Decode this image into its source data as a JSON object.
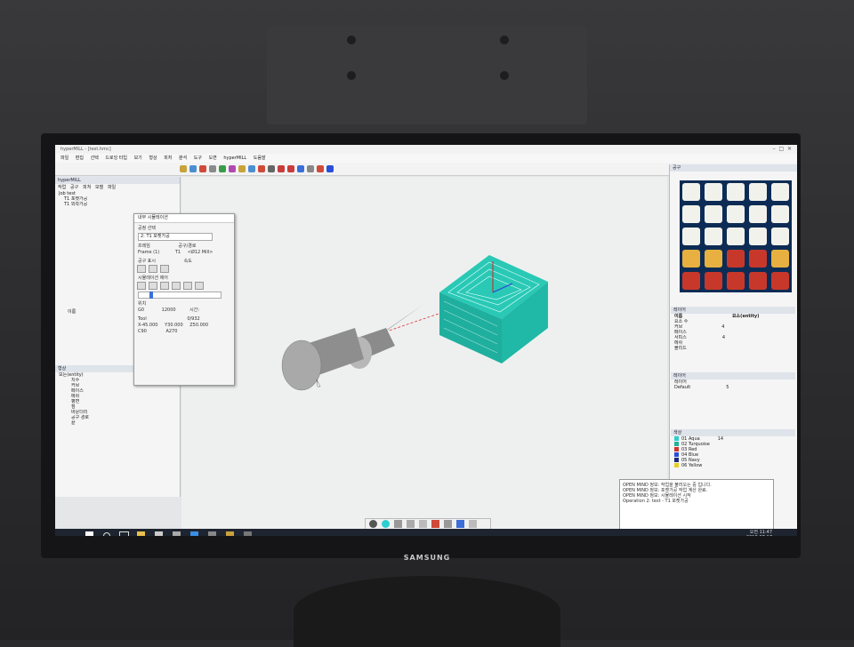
{
  "window": {
    "title": "hyperMILL - [test.hmc]"
  },
  "menu": [
    "파일",
    "편집",
    "선택",
    "드로잉 타입",
    "보기",
    "형상",
    "피처",
    "분석",
    "도구",
    "도면",
    "hyperMILL",
    "도움말"
  ],
  "left_panel": {
    "header": "hyperMILL",
    "tabs": [
      "작업",
      "공구",
      "피쳐",
      "모델",
      "파일"
    ],
    "tree": [
      "Job test",
      "T1 포켓가공",
      "T1 외곽가공"
    ],
    "name_label": "이름"
  },
  "left_bottom": {
    "header": "형상",
    "items": [
      "모든(entity)",
      "치수",
      "커브",
      "페이스",
      "메쉬",
      "평면",
      "점",
      "바운더리",
      "공구 경로",
      "끝"
    ]
  },
  "sim_dialog": {
    "title": "내부 시뮬레이션",
    "operation_label": "공정 선택",
    "operation_value": "2: T1 포켓가공",
    "frame_label": "프레임",
    "frame_value": "Frame (1)",
    "tool_label": "공구/경로",
    "tool_value": "T1",
    "tool_extra": "<Ø12 Mill>",
    "show_label": "공구 표시",
    "speed_label": "속도",
    "sim_label": "시뮬레이션 제어",
    "pos_label": "위치",
    "g_label": "G0",
    "g_value": "12000",
    "time_label": "시간:",
    "tool_info_label": "Tool",
    "count_value": "0/932",
    "x_value": "X-45.000",
    "y_value": "Y30.000",
    "z_value": "Z50.000",
    "c_label": "C90",
    "a_label": "A270"
  },
  "right_panel": {
    "header": "공구",
    "layers_header": "레이어",
    "layers_cols": [
      "이름",
      "요소(entity)"
    ],
    "layers": [
      {
        "name": "요소 수",
        "count": ""
      },
      {
        "name": "커브",
        "count": "4"
      },
      {
        "name": "페이스",
        "count": ""
      },
      {
        "name": "서피스",
        "count": "4"
      },
      {
        "name": "메쉬",
        "count": ""
      },
      {
        "name": "볼리드",
        "count": ""
      }
    ],
    "layer2_header": "레이어",
    "layer2_items": [
      {
        "name": "레이어",
        "count": ""
      },
      {
        "name": "Default",
        "count": "5"
      }
    ],
    "color_header": "색상",
    "colors": [
      {
        "name": "01 Aqua",
        "count": "14",
        "color": "#2ccfd0"
      },
      {
        "name": "02 Turquoise",
        "count": "",
        "color": "#1fb39a"
      },
      {
        "name": "03 Red",
        "count": "",
        "color": "#d8322b"
      },
      {
        "name": "04 Blue",
        "count": "",
        "color": "#2a4fd6"
      },
      {
        "name": "05 Navy",
        "count": "",
        "color": "#1c2a7a"
      },
      {
        "name": "06 Yellow",
        "count": "",
        "color": "#e6cf22"
      }
    ]
  },
  "messages": [
    "OPEN MIND 정보: 작업을 불러오는 중 입니다.",
    "OPEN MIND 정보: 포켓가공 작업 계산 완료.",
    "OPEN MIND 정보: 시뮬레이션 시작",
    "Operation 2: test - T1 포켓가공"
  ],
  "taskbar": {
    "time": "오전 11:47",
    "date": "2018-07-17"
  },
  "brand": "SAMSUNG",
  "colors": {
    "part_top": "#29c9b6",
    "part_side": "#1faf9e",
    "tool_body": "#9a9a9a",
    "palette_bg": "#0d2c55"
  }
}
